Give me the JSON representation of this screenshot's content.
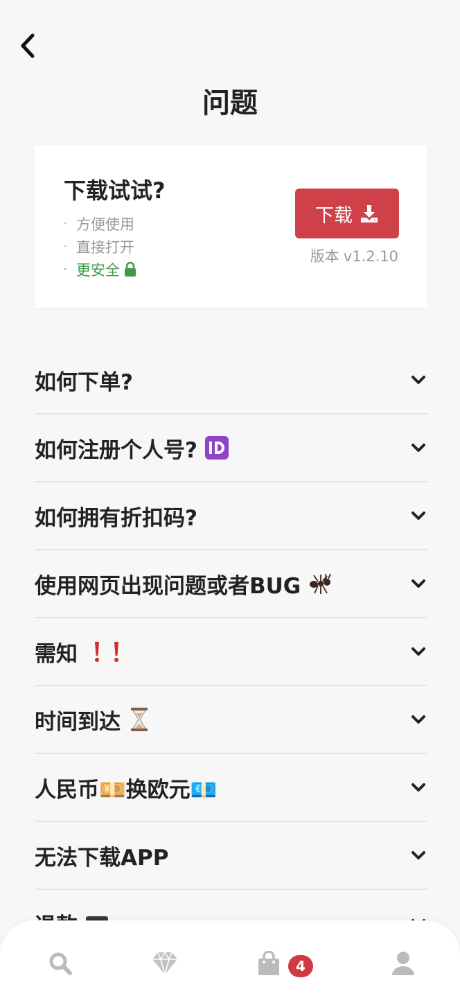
{
  "header": {
    "title": "问题"
  },
  "download_card": {
    "title": "下载试试?",
    "features": [
      {
        "text": "方便使用",
        "color": "#999999"
      },
      {
        "text": "直接打开",
        "color": "#999999"
      },
      {
        "text": "更安全",
        "color": "#3f9b4a"
      }
    ],
    "button_label": "下载",
    "version_label": "版本",
    "version_value": "v1.2.10",
    "button_color": "#cf4148"
  },
  "faq": [
    {
      "label": "如何下单?",
      "emoji": ""
    },
    {
      "label": "如何注册个人号?",
      "emoji": "id-icon"
    },
    {
      "label": "如何拥有折扣码?",
      "emoji": ""
    },
    {
      "label": "使用网页出现问题或者BUG",
      "emoji": "ant-icon"
    },
    {
      "label": "需知",
      "emoji": "double-exclamation-icon"
    },
    {
      "label": "时间到达",
      "emoji": "hourglass-icon"
    },
    {
      "label": "人民币💴换欧元💶",
      "emoji": ""
    },
    {
      "label": "无法下载APP",
      "emoji": ""
    },
    {
      "label": "退款",
      "emoji": "card-icon"
    }
  ],
  "bottom_nav": {
    "items": [
      "search-icon",
      "diamond-icon",
      "bag-icon",
      "user-icon"
    ],
    "cart_badge": "4",
    "active_color": "#bbbbbb"
  }
}
